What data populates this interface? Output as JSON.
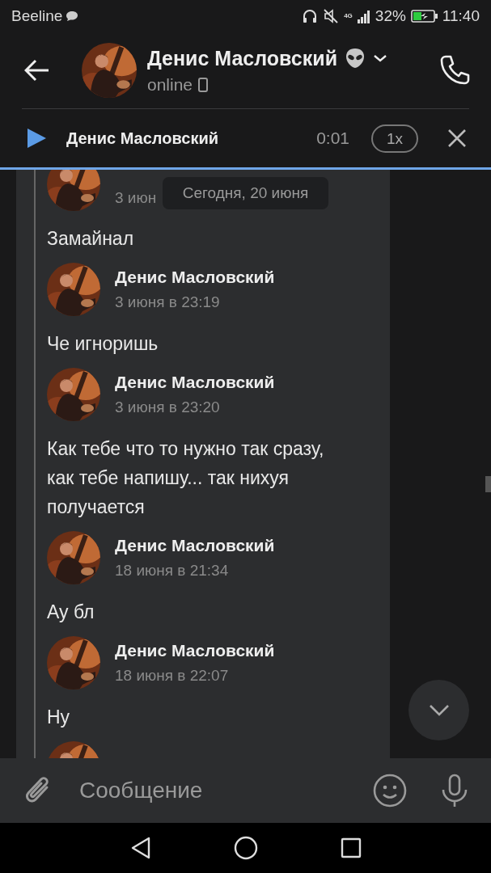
{
  "status_bar": {
    "carrier": "Beeline",
    "network": "4G",
    "battery": "32%",
    "time": "11:40"
  },
  "header": {
    "title": "Денис Масловский",
    "status": "online"
  },
  "player": {
    "title": "Денис Масловский",
    "time": "0:01",
    "speed": "1x"
  },
  "date_pill": "Сегодня, 20 июня",
  "messages": [
    {
      "date": "3 июн",
      "text": "Замайнал"
    },
    {
      "author": "Денис Масловский",
      "date": "3 июня в 23:19",
      "text": "Че игноришь"
    },
    {
      "author": "Денис Масловский",
      "date": "3 июня в 23:20",
      "text": "Как тебе что то нужно так сразу, как тебе напишу... так нихуя получается"
    },
    {
      "author": "Денис Масловский",
      "date": "18 июня в 21:34",
      "text": "Ау бл"
    },
    {
      "author": "Денис Масловский",
      "date": "18 июня в 22:07",
      "text": "Ну"
    }
  ],
  "composer": {
    "placeholder": "Сообщение"
  }
}
